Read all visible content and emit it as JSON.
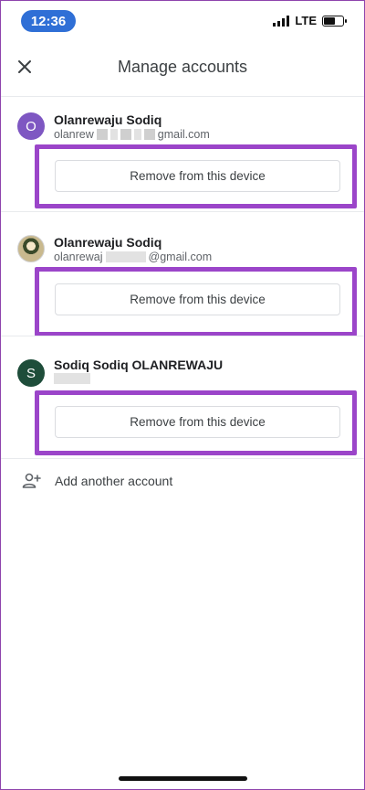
{
  "status_bar": {
    "time": "12:36",
    "network": "LTE",
    "battery_level": 0.65
  },
  "header": {
    "title": "Manage accounts",
    "close_icon": "close-icon"
  },
  "accounts": [
    {
      "avatar_letter": "O",
      "avatar_color": "#7e57c2",
      "name": "Olanrewaju Sodiq",
      "email_prefix": "olanrew",
      "email_suffix": "gmail.com",
      "remove_label": "Remove from this device"
    },
    {
      "avatar_letter": "",
      "avatar_color": "",
      "name": "Olanrewaju Sodiq",
      "email_prefix": "olanrewaj",
      "email_suffix": "@gmail.com",
      "remove_label": "Remove from this device"
    },
    {
      "avatar_letter": "S",
      "avatar_color": "#1e4d3a",
      "name": "Sodiq Sodiq OLANREWAJU",
      "email_prefix": "",
      "email_suffix": "",
      "remove_label": "Remove from this device"
    }
  ],
  "add_account": {
    "label": "Add another account",
    "icon": "add-person-icon"
  },
  "colors": {
    "highlight": "#9b45c9",
    "time_pill": "#2f6fd6"
  }
}
